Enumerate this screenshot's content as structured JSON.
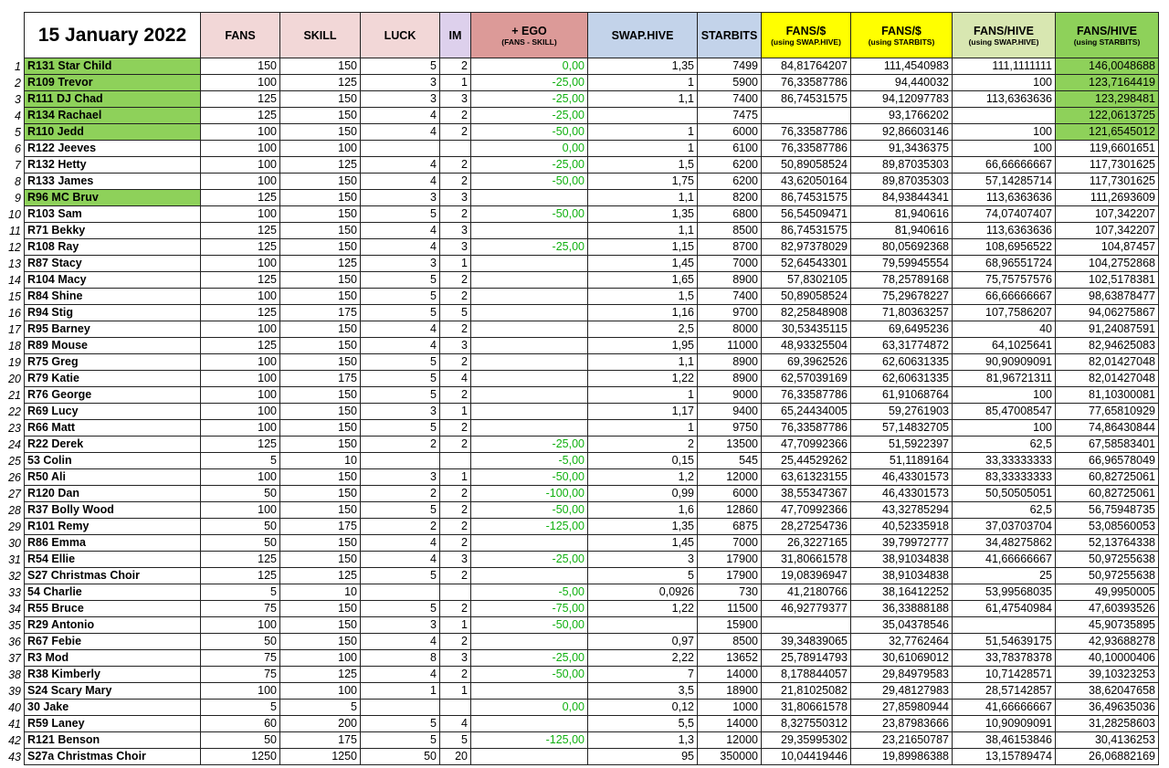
{
  "title": "15 January 2022",
  "headers": {
    "fans": "FANS",
    "skill": "SKILL",
    "luck": "LUCK",
    "im": "IM",
    "ego": "+ EGO",
    "ego_sub": "(FANS - SKILL)",
    "swap": "SWAP.HIVE",
    "starbits": "STARBITS",
    "fans_usd_swap": "FANS/$",
    "fans_usd_swap_sub": "(using SWAP.HIVE)",
    "fans_usd_star": "FANS/$",
    "fans_usd_star_sub": "(using STARBITS)",
    "fans_hive_swap": "FANS/HIVE",
    "fans_hive_swap_sub": "(using SWAP.HIVE)",
    "fans_hive_star": "FANS/HIVE",
    "fans_hive_star_sub": "(using STARBITS)"
  },
  "highlight_color": "#8ed15a",
  "rows": [
    [
      "1",
      "R131 Star Child",
      "150",
      "150",
      "5",
      "2",
      "0,00",
      "1,35",
      "7499",
      "84,81764207",
      "111,4540983",
      "111,1111111",
      "146,0048688"
    ],
    [
      "2",
      "R109 Trevor",
      "100",
      "125",
      "3",
      "1",
      "-25,00",
      "1",
      "5900",
      "76,33587786",
      "94,440032",
      "100",
      "123,7164419"
    ],
    [
      "3",
      "R111 DJ Chad",
      "125",
      "150",
      "3",
      "3",
      "-25,00",
      "1,1",
      "7400",
      "86,74531575",
      "94,12097783",
      "113,6363636",
      "123,298481"
    ],
    [
      "4",
      "R134 Rachael",
      "125",
      "150",
      "4",
      "2",
      "-25,00",
      "",
      "7475",
      "",
      "93,1766202",
      "",
      "122,0613725"
    ],
    [
      "5",
      "R110 Jedd",
      "100",
      "150",
      "4",
      "2",
      "-50,00",
      "1",
      "6000",
      "76,33587786",
      "92,86603146",
      "100",
      "121,6545012"
    ],
    [
      "6",
      "R122 Jeeves",
      "100",
      "100",
      "",
      "",
      "0,00",
      "1",
      "6100",
      "76,33587786",
      "91,3436375",
      "100",
      "119,6601651"
    ],
    [
      "7",
      "R132 Hetty",
      "100",
      "125",
      "4",
      "2",
      "-25,00",
      "1,5",
      "6200",
      "50,89058524",
      "89,87035303",
      "66,66666667",
      "117,7301625"
    ],
    [
      "8",
      "R133 James",
      "100",
      "150",
      "4",
      "2",
      "-50,00",
      "1,75",
      "6200",
      "43,62050164",
      "89,87035303",
      "57,14285714",
      "117,7301625"
    ],
    [
      "9",
      "R96 MC Bruv",
      "125",
      "150",
      "3",
      "3",
      "",
      "1,1",
      "8200",
      "86,74531575",
      "84,93844341",
      "113,6363636",
      "111,2693609"
    ],
    [
      "10",
      "R103 Sam",
      "100",
      "150",
      "5",
      "2",
      "-50,00",
      "1,35",
      "6800",
      "56,54509471",
      "81,940616",
      "74,07407407",
      "107,342207"
    ],
    [
      "11",
      "R71 Bekky",
      "125",
      "150",
      "4",
      "3",
      "",
      "1,1",
      "8500",
      "86,74531575",
      "81,940616",
      "113,6363636",
      "107,342207"
    ],
    [
      "12",
      "R108 Ray",
      "125",
      "150",
      "4",
      "3",
      "-25,00",
      "1,15",
      "8700",
      "82,97378029",
      "80,05692368",
      "108,6956522",
      "104,87457"
    ],
    [
      "13",
      "R87 Stacy",
      "100",
      "125",
      "3",
      "1",
      "",
      "1,45",
      "7000",
      "52,64543301",
      "79,59945554",
      "68,96551724",
      "104,2752868"
    ],
    [
      "14",
      "R104 Macy",
      "125",
      "150",
      "5",
      "2",
      "",
      "1,65",
      "8900",
      "57,8302105",
      "78,25789168",
      "75,75757576",
      "102,5178381"
    ],
    [
      "15",
      "R84 Shine",
      "100",
      "150",
      "5",
      "2",
      "",
      "1,5",
      "7400",
      "50,89058524",
      "75,29678227",
      "66,66666667",
      "98,63878477"
    ],
    [
      "16",
      "R94 Stig",
      "125",
      "175",
      "5",
      "5",
      "",
      "1,16",
      "9700",
      "82,25848908",
      "71,80363257",
      "107,7586207",
      "94,06275867"
    ],
    [
      "17",
      "R95 Barney",
      "100",
      "150",
      "4",
      "2",
      "",
      "2,5",
      "8000",
      "30,53435115",
      "69,6495236",
      "40",
      "91,24087591"
    ],
    [
      "18",
      "R89 Mouse",
      "125",
      "150",
      "4",
      "3",
      "",
      "1,95",
      "11000",
      "48,93325504",
      "63,31774872",
      "64,1025641",
      "82,94625083"
    ],
    [
      "19",
      "R75 Greg",
      "100",
      "150",
      "5",
      "2",
      "",
      "1,1",
      "8900",
      "69,3962526",
      "62,60631335",
      "90,90909091",
      "82,01427048"
    ],
    [
      "20",
      "R79 Katie",
      "100",
      "175",
      "5",
      "4",
      "",
      "1,22",
      "8900",
      "62,57039169",
      "62,60631335",
      "81,96721311",
      "82,01427048"
    ],
    [
      "21",
      "R76 George",
      "100",
      "150",
      "5",
      "2",
      "",
      "1",
      "9000",
      "76,33587786",
      "61,91068764",
      "100",
      "81,10300081"
    ],
    [
      "22",
      "R69 Lucy",
      "100",
      "150",
      "3",
      "1",
      "",
      "1,17",
      "9400",
      "65,24434005",
      "59,2761903",
      "85,47008547",
      "77,65810929"
    ],
    [
      "23",
      "R66 Matt",
      "100",
      "150",
      "5",
      "2",
      "",
      "1",
      "9750",
      "76,33587786",
      "57,14832705",
      "100",
      "74,86430844"
    ],
    [
      "24",
      "R22 Derek",
      "125",
      "150",
      "2",
      "2",
      "-25,00",
      "2",
      "13500",
      "47,70992366",
      "51,5922397",
      "62,5",
      "67,58583401"
    ],
    [
      "25",
      "53 Colin",
      "5",
      "10",
      "",
      "",
      "-5,00",
      "0,15",
      "545",
      "25,44529262",
      "51,1189164",
      "33,33333333",
      "66,96578049"
    ],
    [
      "26",
      "R50 Ali",
      "100",
      "150",
      "3",
      "1",
      "-50,00",
      "1,2",
      "12000",
      "63,61323155",
      "46,43301573",
      "83,33333333",
      "60,82725061"
    ],
    [
      "27",
      "R120 Dan",
      "50",
      "150",
      "2",
      "2",
      "-100,00",
      "0,99",
      "6000",
      "38,55347367",
      "46,43301573",
      "50,50505051",
      "60,82725061"
    ],
    [
      "28",
      "R37 Bolly Wood",
      "100",
      "150",
      "5",
      "2",
      "-50,00",
      "1,6",
      "12860",
      "47,70992366",
      "43,32785294",
      "62,5",
      "56,75948735"
    ],
    [
      "29",
      "R101 Remy",
      "50",
      "175",
      "2",
      "2",
      "-125,00",
      "1,35",
      "6875",
      "28,27254736",
      "40,52335918",
      "37,03703704",
      "53,08560053"
    ],
    [
      "30",
      "R86 Emma",
      "50",
      "150",
      "4",
      "2",
      "",
      "1,45",
      "7000",
      "26,3227165",
      "39,79972777",
      "34,48275862",
      "52,13764338"
    ],
    [
      "31",
      "R54 Ellie",
      "125",
      "150",
      "4",
      "3",
      "-25,00",
      "3",
      "17900",
      "31,80661578",
      "38,91034838",
      "41,66666667",
      "50,97255638"
    ],
    [
      "32",
      "S27 Christmas Choir",
      "125",
      "125",
      "5",
      "2",
      "",
      "5",
      "17900",
      "19,08396947",
      "38,91034838",
      "25",
      "50,97255638"
    ],
    [
      "33",
      "54 Charlie",
      "5",
      "10",
      "",
      "",
      "-5,00",
      "0,0926",
      "730",
      "41,2180766",
      "38,16412252",
      "53,99568035",
      "49,9950005"
    ],
    [
      "34",
      "R55 Bruce",
      "75",
      "150",
      "5",
      "2",
      "-75,00",
      "1,22",
      "11500",
      "46,92779377",
      "36,33888188",
      "61,47540984",
      "47,60393526"
    ],
    [
      "35",
      "R29 Antonio",
      "100",
      "150",
      "3",
      "1",
      "-50,00",
      "",
      "15900",
      "",
      "35,04378546",
      "",
      "45,90735895"
    ],
    [
      "36",
      "R67 Febie",
      "50",
      "150",
      "4",
      "2",
      "",
      "0,97",
      "8500",
      "39,34839065",
      "32,7762464",
      "51,54639175",
      "42,93688278"
    ],
    [
      "37",
      "R3 Mod",
      "75",
      "100",
      "8",
      "3",
      "-25,00",
      "2,22",
      "13652",
      "25,78914793",
      "30,61069012",
      "33,78378378",
      "40,10000406"
    ],
    [
      "38",
      "R38 Kimberly",
      "75",
      "125",
      "4",
      "2",
      "-50,00",
      "7",
      "14000",
      "8,178844057",
      "29,84979583",
      "10,71428571",
      "39,10323253"
    ],
    [
      "39",
      "S24 Scary Mary",
      "100",
      "100",
      "1",
      "1",
      "",
      "3,5",
      "18900",
      "21,81025082",
      "29,48127983",
      "28,57142857",
      "38,62047658"
    ],
    [
      "40",
      "30 Jake",
      "5",
      "5",
      "",
      "",
      "0,00",
      "0,12",
      "1000",
      "31,80661578",
      "27,85980944",
      "41,66666667",
      "36,49635036"
    ],
    [
      "41",
      "R59 Laney",
      "60",
      "200",
      "5",
      "4",
      "",
      "5,5",
      "14000",
      "8,327550312",
      "23,87983666",
      "10,90909091",
      "31,28258603"
    ],
    [
      "42",
      "R121 Benson",
      "50",
      "175",
      "5",
      "5",
      "-125,00",
      "1,3",
      "12000",
      "29,35995302",
      "23,21650787",
      "38,46153846",
      "30,4136253"
    ],
    [
      "43",
      "S27a Christmas Choir",
      "1250",
      "1250",
      "50",
      "20",
      "",
      "95",
      "350000",
      "10,04419446",
      "19,89986388",
      "13,15789474",
      "26,06882169"
    ]
  ],
  "highlighted_names": [
    "1",
    "2",
    "3",
    "4",
    "5",
    "9"
  ],
  "highlighted_last": [
    "1",
    "2",
    "3",
    "4",
    "5"
  ]
}
